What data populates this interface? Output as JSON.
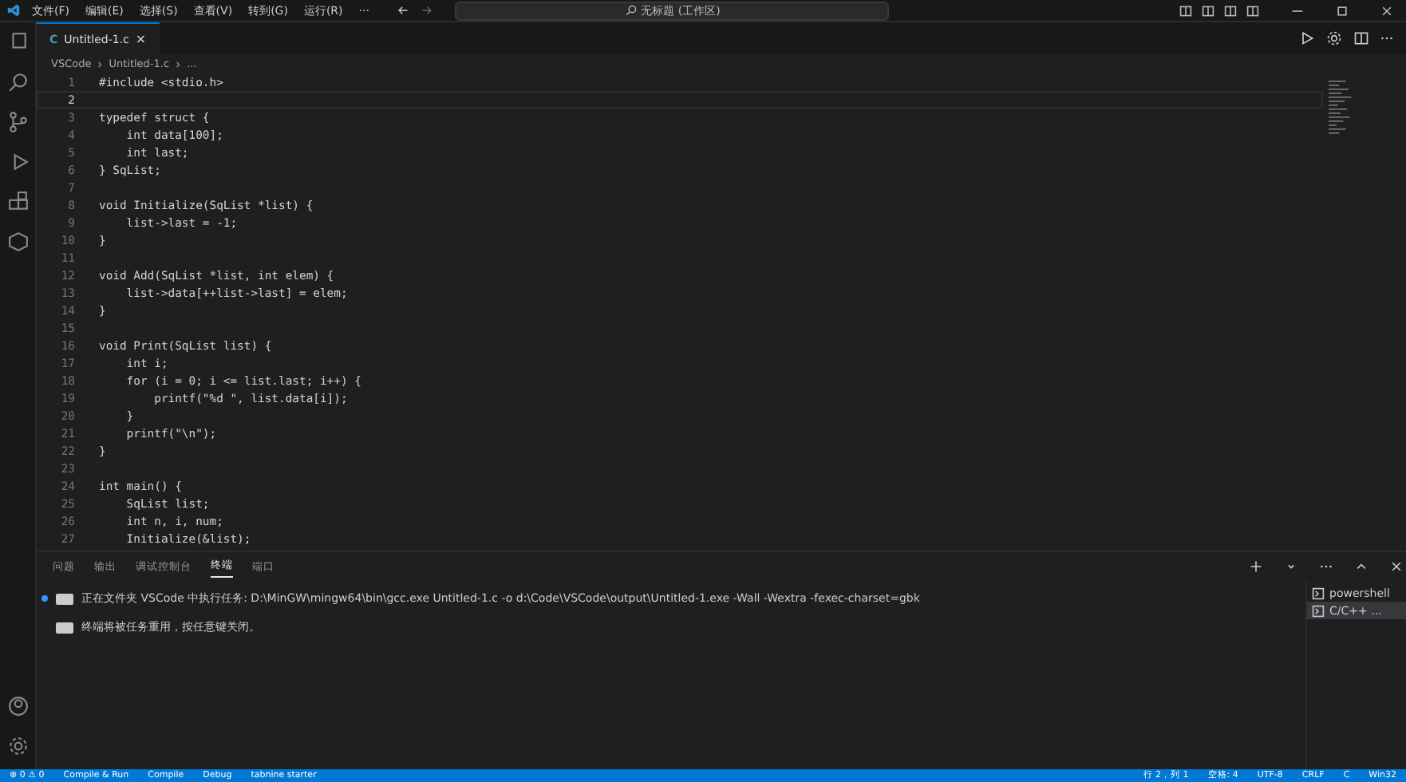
{
  "menu": [
    "文件(F)",
    "编辑(E)",
    "选择(S)",
    "查看(V)",
    "转到(G)",
    "运行(R)",
    "···"
  ],
  "command_center": {
    "text": "无标题 (工作区)"
  },
  "editor_tabs": [
    {
      "icon": "C",
      "label": "Untitled-1.c",
      "close": "×",
      "selected": true
    }
  ],
  "breadcrumb": [
    "VSCode",
    "Untitled-1.c",
    "..."
  ],
  "code": [
    {
      "number": "1",
      "text": "#include <stdio.h>",
      "selected": false
    },
    {
      "number": "2",
      "selected": true
    },
    {
      "number": "3",
      "text": "typedef struct {",
      "selected": false
    },
    {
      "number": "4",
      "text": "    int data[100];",
      "selected": false
    },
    {
      "number": "5",
      "text": "    int last;",
      "selected": false
    },
    {
      "number": "6",
      "text": "} SqList;",
      "selected": false
    },
    {
      "number": "7",
      "selected": false
    },
    {
      "number": "8",
      "text": "void Initialize(SqList *list) {",
      "selected": false
    },
    {
      "number": "9",
      "text": "    list->last = -1;",
      "selected": false
    },
    {
      "number": "10",
      "text": "}",
      "selected": false
    },
    {
      "number": "11",
      "selected": false
    },
    {
      "number": "12",
      "text": "void Add(SqList *list, int elem) {",
      "selected": false
    },
    {
      "number": "13",
      "text": "    list->data[++list->last] = elem;",
      "selected": false
    },
    {
      "number": "14",
      "text": "}",
      "selected": false
    },
    {
      "number": "15",
      "selected": false
    },
    {
      "number": "16",
      "text": "void Print(SqList list) {",
      "selected": false
    },
    {
      "number": "17",
      "text": "    int i;",
      "selected": false
    },
    {
      "number": "18",
      "text": "    for (i = 0; i <= list.last; i++) {",
      "selected": false
    },
    {
      "number": "19",
      "text": "        printf(\"%d \", list.data[i]);",
      "selected": false
    },
    {
      "number": "20",
      "text": "    }",
      "selected": false
    },
    {
      "number": "21",
      "text": "    printf(\"\\n\");",
      "selected": false
    },
    {
      "number": "22",
      "text": "}",
      "selected": false
    },
    {
      "number": "23",
      "selected": false
    },
    {
      "number": "24",
      "text": "int main() {",
      "selected": false
    },
    {
      "number": "25",
      "text": "    SqList list;",
      "selected": false
    },
    {
      "number": "26",
      "text": "    int n, i, num;",
      "selected": false
    },
    {
      "number": "27",
      "text": "    Initialize(&list);",
      "selected": false
    }
  ],
  "panel_tabs": [
    {
      "label": "问题",
      "selected": false
    },
    {
      "label": "输出",
      "selected": false
    },
    {
      "label": "调试控制台",
      "selected": false
    },
    {
      "label": "终端",
      "selected": true
    },
    {
      "label": "端口",
      "selected": false
    }
  ],
  "terminal_lines": [
    "正在文件夹 VSCode 中执行任务: D:\\MinGW\\mingw64\\bin\\gcc.exe Untitled-1.c -o d:\\Code\\VSCode\\output\\Untitled-1.exe -Wall -Wextra -fexec-charset=gbk",
    "终端将被任务重用，按任意键关闭。"
  ],
  "terminals": [
    {
      "label": "powershell",
      "selected": false
    },
    {
      "label": "C/C++ ...",
      "selected": true
    }
  ],
  "status_left": [
    "⊗ 0 ⚠ 0",
    "Compile & Run",
    "Compile",
    "Debug",
    "tabnine starter"
  ],
  "status_right": [
    "行 2，列 1",
    "空格: 4",
    "UTF-8",
    "CRLF",
    "C",
    "Win32"
  ]
}
